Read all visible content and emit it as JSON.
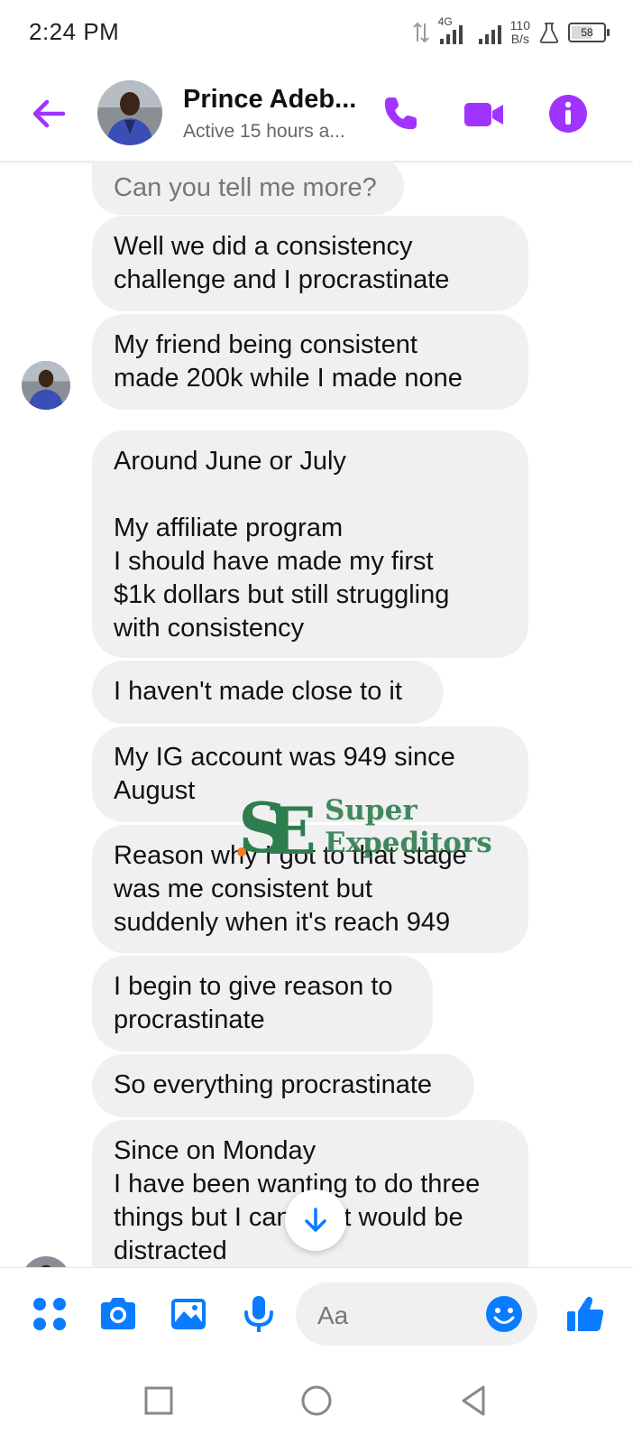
{
  "status_bar": {
    "time": "2:24 PM",
    "network": "4G",
    "speed_value": "110",
    "speed_unit": "B/s",
    "battery": "58"
  },
  "header": {
    "contact_name": "Prince Adeb...",
    "active_status": "Active 15 hours a..."
  },
  "messages": [
    {
      "text": "Can you tell me more?"
    },
    {
      "text": "Well we did a consistency\nchallenge and I procrastinate"
    },
    {
      "text": "My friend being consistent\nmade 200k while I made none"
    },
    {
      "text": "Around June or July\n\nMy affiliate program\nI should have made my first\n$1k dollars but still struggling\nwith consistency"
    },
    {
      "text": "I haven't made close to it"
    },
    {
      "text": "My IG account was 949 since\nAugust"
    },
    {
      "text": "Reason why I got to that stage\nwas me consistent but\nsuddenly when it's reach 949"
    },
    {
      "text": "I begin to give reason to\nprocrastinate"
    },
    {
      "text": "So everything procrastinate"
    },
    {
      "text": "Since on Monday\nI have been wanting to do three\nthings but I can't just would be\ndistracted"
    }
  ],
  "watermark": {
    "line1": "Super",
    "line2": "Expeditors"
  },
  "composer": {
    "placeholder": "Aa"
  },
  "colors": {
    "accent": "#a033ff",
    "blue": "#0a7cff",
    "bubble": "#f0f0f0",
    "watermark_green": "#2e7d4f",
    "watermark_orange": "#f57c20"
  }
}
